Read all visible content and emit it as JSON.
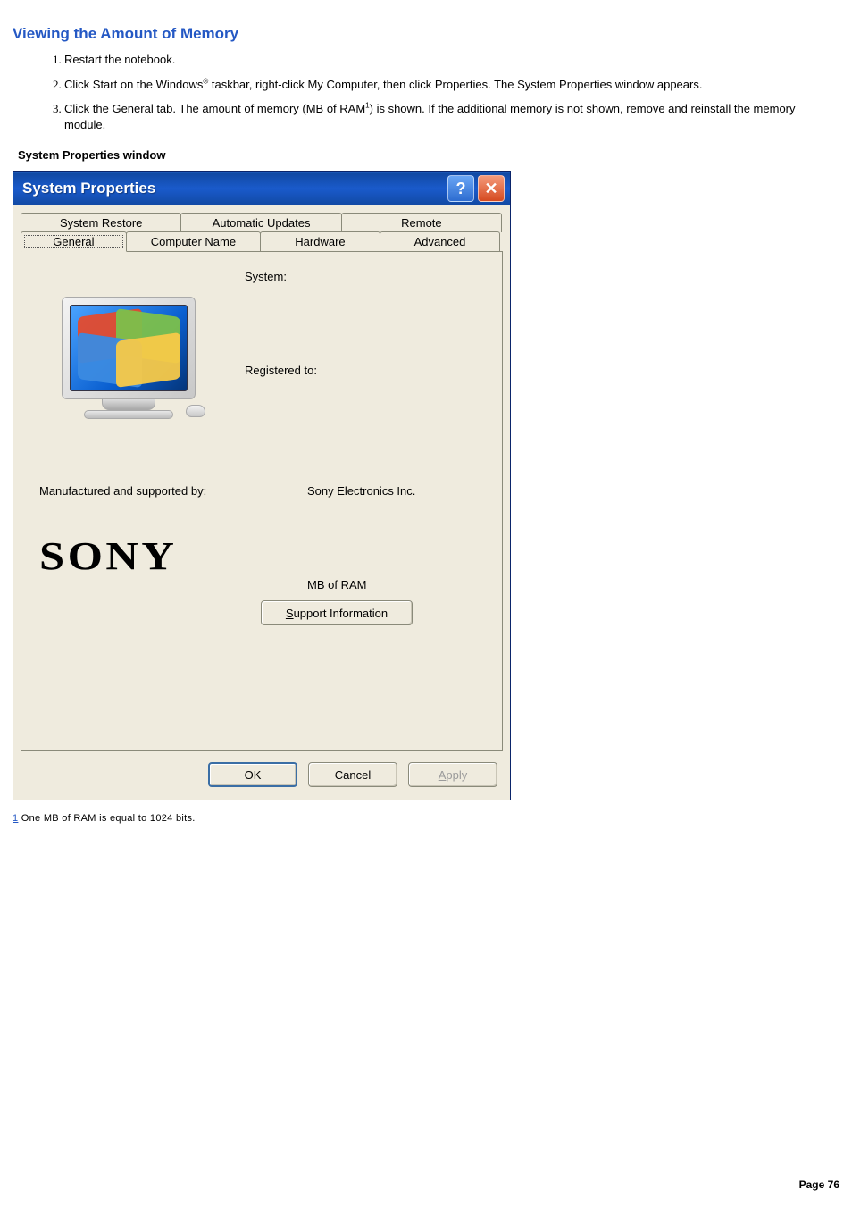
{
  "heading": "Viewing the Amount of Memory",
  "steps": [
    "Restart the notebook.",
    "Click Start on the Windows® taskbar, right-click My Computer, then click Properties. The System Properties window appears.",
    "Click the General tab. The amount of memory (MB of RAM¹) is shown. If the additional memory is not shown, remove and reinstall the memory module."
  ],
  "caption": "System Properties window",
  "window": {
    "title": "System Properties",
    "tabs_row1": [
      "System Restore",
      "Automatic Updates",
      "Remote"
    ],
    "tabs_row2": [
      "General",
      "Computer Name",
      "Hardware",
      "Advanced"
    ],
    "active_tab": "General",
    "labels": {
      "system": "System:",
      "registered_to": "Registered to:",
      "manufactured_by": "Manufactured and supported by:",
      "manufacturer_value": "Sony Electronics Inc.",
      "ram": "MB of RAM",
      "logo": "SONY",
      "support_btn": "Support Information",
      "support_accel": "S"
    },
    "buttons": {
      "ok": "OK",
      "cancel": "Cancel",
      "apply": "Apply",
      "apply_accel": "A"
    }
  },
  "footnote": {
    "ref": "1",
    "text": "One MB of RAM is equal to 1024 bits."
  },
  "page_number": "Page 76"
}
